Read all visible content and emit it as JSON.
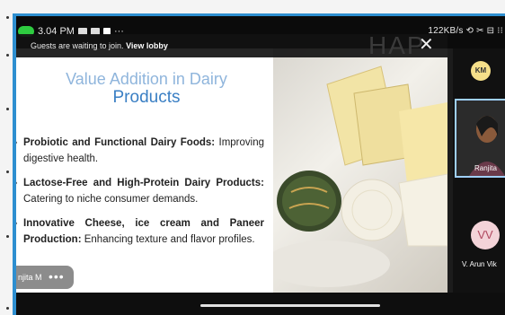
{
  "status_bar": {
    "time": "3.04 PM",
    "right_text": "122KB/s ⟲ ✂ ⊟ ⁝⁝"
  },
  "banner": {
    "message": "Guests are waiting to join.",
    "link_label": "View lobby",
    "logo_text": "HAP",
    "close_glyph": "✕"
  },
  "slide": {
    "title_line1": "Value Addition in Dairy",
    "title_line2": "Products",
    "bullets": [
      {
        "bold": "Probiotic and Functional Dairy Foods:",
        "text": " Improving digestive health."
      },
      {
        "bold": "Lactose-Free and High-Protein Dairy Products:",
        "text": " Catering to niche consumer demands."
      },
      {
        "bold": "Innovative Cheese, ice cream and Paneer Production:",
        "text": " Enhancing texture and flavor profiles."
      }
    ]
  },
  "presenter_pill": {
    "name": "njita M",
    "more_glyph": "•••"
  },
  "participants": {
    "top_avatar": "KM",
    "active_tile_label": "Ranjita",
    "second_avatar": "VV",
    "second_label": "V. Arun Vik"
  },
  "colors": {
    "accent_border": "#2e8fd0",
    "slide_title": "#3a7fc4",
    "status_green": "#2ecc40"
  }
}
